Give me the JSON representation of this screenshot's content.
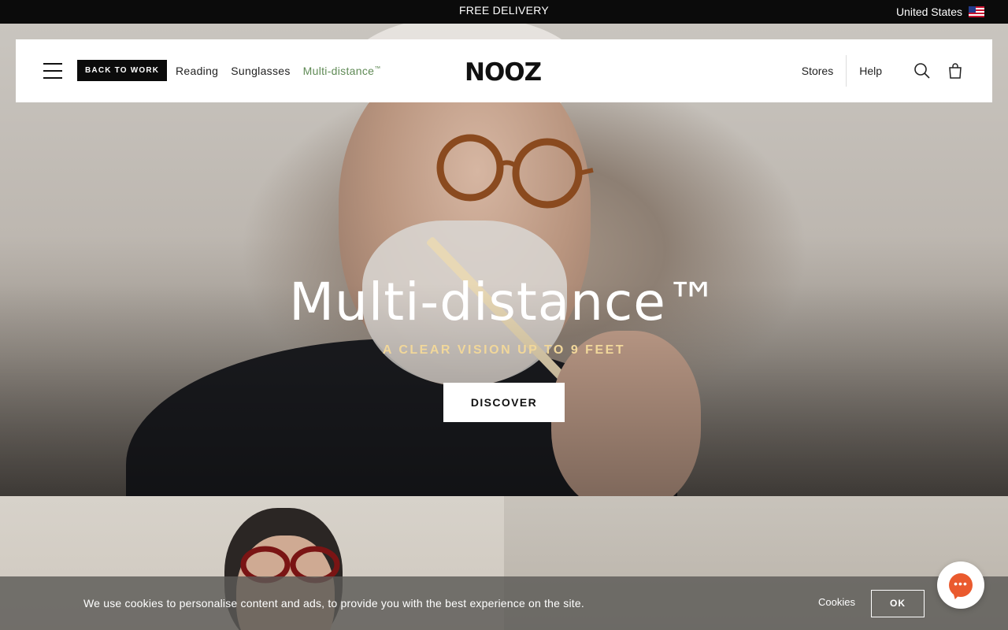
{
  "announcement": {
    "promo": "FREE DELIVERY",
    "country": "United States",
    "flag_icon": "us-flag-icon"
  },
  "header": {
    "back_to_work": "BACK TO WORK",
    "nav": [
      {
        "label": "Reading"
      },
      {
        "label": "Sunglasses"
      },
      {
        "label": "Multi-distance",
        "tm": "™",
        "color": "#5f8a55"
      }
    ],
    "logo": "NOOZ",
    "stores": "Stores",
    "help": "Help",
    "icons": [
      "menu-icon",
      "search-icon",
      "bag-icon"
    ]
  },
  "hero": {
    "title": "Multi-distance™",
    "subtitle": "A CLEAR VISION UP TO 9 FEET",
    "subtitle_color": "#f1d79a",
    "cta": "DISCOVER"
  },
  "cookie": {
    "text": "We use cookies to personalise content and ads, to provide you with the best experience on the site.",
    "settings": "Cookies",
    "ok": "OK"
  },
  "chat": {
    "icon": "chat-icon",
    "accent": "#ea5a2e"
  }
}
